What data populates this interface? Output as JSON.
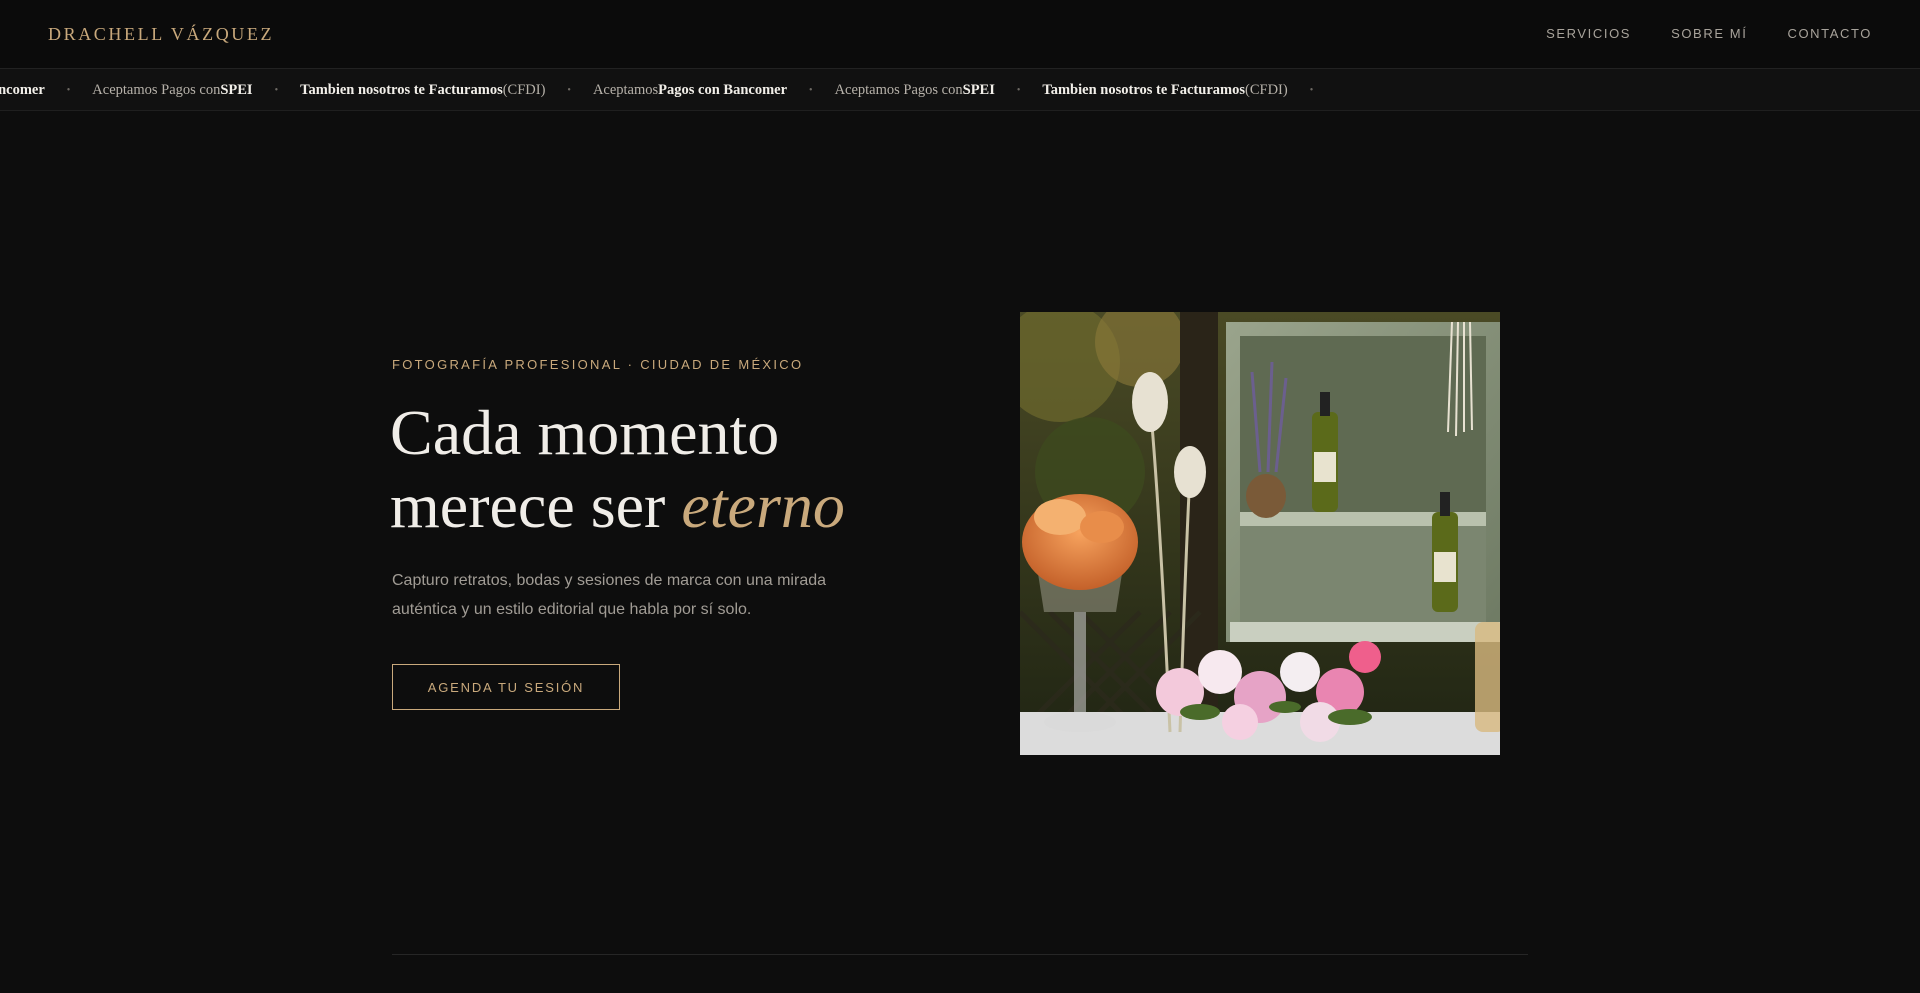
{
  "header": {
    "brand": "DRACHELL VÁZQUEZ",
    "nav": [
      {
        "label": "SERVICIOS"
      },
      {
        "label": "SOBRE MÍ"
      },
      {
        "label": "CONTACTO"
      }
    ]
  },
  "ticker": {
    "items": [
      {
        "pre": "",
        "bold": "gos con Bancomer",
        "post": ""
      },
      {
        "pre": "Aceptamos Pagos con ",
        "bold": "SPEI",
        "post": ""
      },
      {
        "pre": "",
        "bold": "Tambien nosotros te Facturamos",
        "post": " (CFDI)"
      },
      {
        "pre": "Aceptamos ",
        "bold": "Pagos con Bancomer",
        "post": ""
      },
      {
        "pre": "Aceptamos Pagos con ",
        "bold": "SPEI",
        "post": ""
      },
      {
        "pre": "",
        "bold": "Tambien nosotros te Facturamos",
        "post": " (CFDI)"
      }
    ],
    "separator": "•"
  },
  "hero": {
    "eyebrow": "FOTOGRAFÍA PROFESIONAL · CIUDAD DE MÉXICO",
    "title_line1": "Cada momento",
    "title_line2": "merece ser ",
    "title_accent": "eterno",
    "subtitle": "Capturo retratos, bodas y sesiones de marca con una mirada auténtica y un estilo editorial que habla por sí solo.",
    "cta_label": "AGENDA TU SESIÓN"
  },
  "colors": {
    "background": "#0d0d0d",
    "accent_gold": "#c9a97c",
    "text_primary": "#f0ede8",
    "text_muted": "#a19c95"
  }
}
